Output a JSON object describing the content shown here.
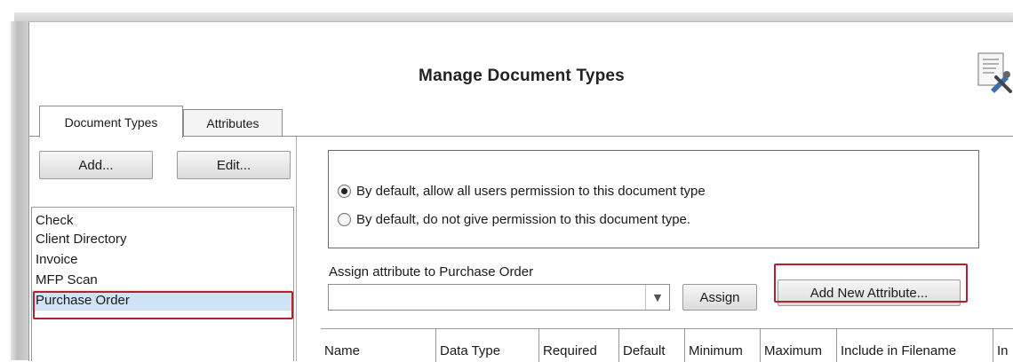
{
  "window": {
    "title": "Manage Document Types"
  },
  "tabs": [
    {
      "label": "Document Types",
      "active": true
    },
    {
      "label": "Attributes",
      "active": false
    }
  ],
  "left_panel": {
    "add_label": "Add...",
    "edit_label": "Edit...",
    "document_types": [
      {
        "label": "Check",
        "selected": false
      },
      {
        "label": "Client Directory",
        "selected": false
      },
      {
        "label": "Invoice",
        "selected": false
      },
      {
        "label": "MFP Scan",
        "selected": false
      },
      {
        "label": "Purchase Order",
        "selected": true
      }
    ]
  },
  "permissions": {
    "options": [
      {
        "label": "By default, allow all users permission to this document type",
        "checked": true
      },
      {
        "label": "By default, do not give permission to this document type.",
        "checked": false
      }
    ]
  },
  "assign": {
    "label": "Assign attribute to Purchase Order",
    "combo_value": "",
    "assign_button": "Assign",
    "add_new_button": "Add New Attribute..."
  },
  "table": {
    "columns": [
      "Name",
      "Data Type",
      "Required",
      "Default",
      "Minimum",
      "Maximum",
      "Include in Filename",
      "In"
    ]
  },
  "colors": {
    "highlight": "#b1232c",
    "selection": "#cfe2f6"
  }
}
